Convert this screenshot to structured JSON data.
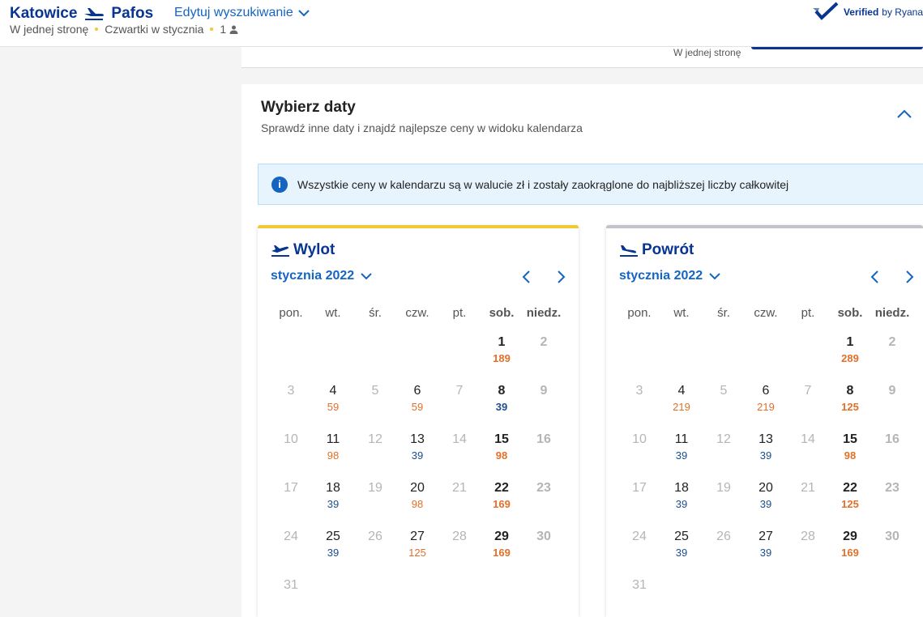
{
  "header": {
    "from": "Katowice",
    "to": "Pafos",
    "edit_label": "Edytuj wyszukiwanie",
    "trip_type": "W jednej stronę",
    "dates": "Czwartki w stycznia",
    "passengers": "1",
    "verified_label": "Verified",
    "verified_by": "by Ryana"
  },
  "prev_card": {
    "label": "W jednej stronę"
  },
  "card": {
    "title": "Wybierz daty",
    "subtitle": "Sprawdź inne daty i znajdź najlepsze ceny w widoku kalendarza",
    "info": "Wszystkie ceny w kalendarzu są w walucie zł i zostały zaokrąglone do najbliższej liczby całkowitej"
  },
  "weekdays": [
    "pon.",
    "wt.",
    "śr.",
    "czw.",
    "pt.",
    "sob.",
    "niedz."
  ],
  "outbound": {
    "title": "Wylot",
    "month": "stycznia 2022",
    "days": [
      {
        "d": "",
        "p": ""
      },
      {
        "d": "",
        "p": ""
      },
      {
        "d": "",
        "p": ""
      },
      {
        "d": "",
        "p": ""
      },
      {
        "d": "",
        "p": ""
      },
      {
        "d": "1",
        "p": "189",
        "c": "orange"
      },
      {
        "d": "2",
        "p": "",
        "dis": true
      },
      {
        "d": "3",
        "p": "",
        "dis": true
      },
      {
        "d": "4",
        "p": "59",
        "c": "orange"
      },
      {
        "d": "5",
        "p": "",
        "dis": true
      },
      {
        "d": "6",
        "p": "59",
        "c": "orange"
      },
      {
        "d": "7",
        "p": "",
        "dis": true
      },
      {
        "d": "8",
        "p": "39",
        "c": "blue"
      },
      {
        "d": "9",
        "p": "",
        "dis": true
      },
      {
        "d": "10",
        "p": "",
        "dis": true
      },
      {
        "d": "11",
        "p": "98",
        "c": "orange"
      },
      {
        "d": "12",
        "p": "",
        "dis": true
      },
      {
        "d": "13",
        "p": "39",
        "c": "blue"
      },
      {
        "d": "14",
        "p": "",
        "dis": true
      },
      {
        "d": "15",
        "p": "98",
        "c": "orange"
      },
      {
        "d": "16",
        "p": "",
        "dis": true
      },
      {
        "d": "17",
        "p": "",
        "dis": true
      },
      {
        "d": "18",
        "p": "39",
        "c": "blue"
      },
      {
        "d": "19",
        "p": "",
        "dis": true
      },
      {
        "d": "20",
        "p": "98",
        "c": "orange"
      },
      {
        "d": "21",
        "p": "",
        "dis": true
      },
      {
        "d": "22",
        "p": "169",
        "c": "orange"
      },
      {
        "d": "23",
        "p": "",
        "dis": true
      },
      {
        "d": "24",
        "p": "",
        "dis": true
      },
      {
        "d": "25",
        "p": "39",
        "c": "blue"
      },
      {
        "d": "26",
        "p": "",
        "dis": true
      },
      {
        "d": "27",
        "p": "125",
        "c": "orange"
      },
      {
        "d": "28",
        "p": "",
        "dis": true
      },
      {
        "d": "29",
        "p": "169",
        "c": "orange"
      },
      {
        "d": "30",
        "p": "",
        "dis": true
      },
      {
        "d": "31",
        "p": "",
        "dis": true
      }
    ]
  },
  "return": {
    "title": "Powrót",
    "month": "stycznia 2022",
    "days": [
      {
        "d": "",
        "p": ""
      },
      {
        "d": "",
        "p": ""
      },
      {
        "d": "",
        "p": ""
      },
      {
        "d": "",
        "p": ""
      },
      {
        "d": "",
        "p": ""
      },
      {
        "d": "1",
        "p": "289",
        "c": "orange"
      },
      {
        "d": "2",
        "p": "",
        "dis": true
      },
      {
        "d": "3",
        "p": "",
        "dis": true
      },
      {
        "d": "4",
        "p": "219",
        "c": "orange"
      },
      {
        "d": "5",
        "p": "",
        "dis": true
      },
      {
        "d": "6",
        "p": "219",
        "c": "orange"
      },
      {
        "d": "7",
        "p": "",
        "dis": true
      },
      {
        "d": "8",
        "p": "125",
        "c": "orange"
      },
      {
        "d": "9",
        "p": "",
        "dis": true
      },
      {
        "d": "10",
        "p": "",
        "dis": true
      },
      {
        "d": "11",
        "p": "39",
        "c": "blue"
      },
      {
        "d": "12",
        "p": "",
        "dis": true
      },
      {
        "d": "13",
        "p": "39",
        "c": "blue"
      },
      {
        "d": "14",
        "p": "",
        "dis": true
      },
      {
        "d": "15",
        "p": "98",
        "c": "orange"
      },
      {
        "d": "16",
        "p": "",
        "dis": true
      },
      {
        "d": "17",
        "p": "",
        "dis": true
      },
      {
        "d": "18",
        "p": "39",
        "c": "blue"
      },
      {
        "d": "19",
        "p": "",
        "dis": true
      },
      {
        "d": "20",
        "p": "39",
        "c": "blue"
      },
      {
        "d": "21",
        "p": "",
        "dis": true
      },
      {
        "d": "22",
        "p": "125",
        "c": "orange"
      },
      {
        "d": "23",
        "p": "",
        "dis": true
      },
      {
        "d": "24",
        "p": "",
        "dis": true
      },
      {
        "d": "25",
        "p": "39",
        "c": "blue"
      },
      {
        "d": "26",
        "p": "",
        "dis": true
      },
      {
        "d": "27",
        "p": "39",
        "c": "blue"
      },
      {
        "d": "28",
        "p": "",
        "dis": true
      },
      {
        "d": "29",
        "p": "169",
        "c": "orange"
      },
      {
        "d": "30",
        "p": "",
        "dis": true
      },
      {
        "d": "31",
        "p": "",
        "dis": true
      }
    ]
  },
  "colors": {
    "brand": "#073590",
    "accent": "#f1c933",
    "link": "#1565c0",
    "price_orange": "#e0702a",
    "price_blue": "#1b4f8c"
  }
}
